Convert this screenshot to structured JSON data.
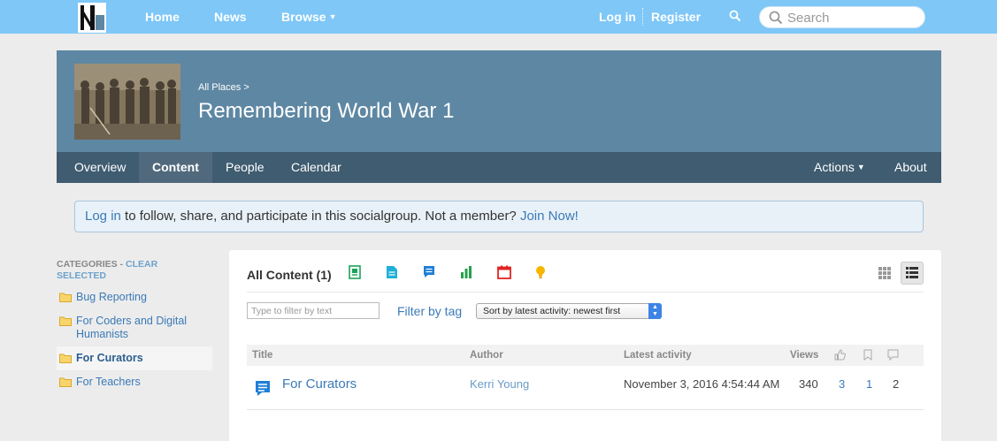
{
  "topnav": {
    "home": "Home",
    "news": "News",
    "browse": "Browse",
    "login": "Log in",
    "register": "Register",
    "search_placeholder": "Search"
  },
  "header": {
    "breadcrumb": "All Places >",
    "title": "Remembering World War 1"
  },
  "tabs": {
    "overview": "Overview",
    "content": "Content",
    "people": "People",
    "calendar": "Calendar",
    "actions": "Actions",
    "about": "About"
  },
  "notice": {
    "login_link": "Log in",
    "middle_text": " to follow, share, and participate in this socialgroup. Not a member? ",
    "join_link": "Join Now!"
  },
  "sidebar": {
    "heading": "CATEGORIES - ",
    "clear": "CLEAR SELECTED",
    "items": [
      {
        "label": "Bug Reporting"
      },
      {
        "label": "For Coders and Digital Humanists"
      },
      {
        "label": "For Curators"
      },
      {
        "label": "For Teachers"
      }
    ]
  },
  "content": {
    "all_label": "All Content (1)",
    "type_icons": [
      "document-icon",
      "file-icon",
      "discussion-icon",
      "poll-icon",
      "event-icon",
      "idea-icon"
    ],
    "filter_placeholder": "Type to filter by text",
    "filter_tag": "Filter by tag",
    "sort_selected": "Sort by latest activity: newest first",
    "columns": {
      "title": "Title",
      "author": "Author",
      "latest_activity": "Latest activity",
      "views": "Views"
    },
    "rows": [
      {
        "title": "For Curators",
        "author": "Kerri Young",
        "latest_activity": "November 3, 2016 4:54:44 AM",
        "views": "340",
        "likes": "3",
        "bookmarks": "1",
        "comments": "2"
      }
    ]
  },
  "colors": {
    "topnav": "#7ec7f7",
    "banner": "#5e87a3",
    "subnav": "#3f5c70",
    "link": "#3a7ab7"
  }
}
